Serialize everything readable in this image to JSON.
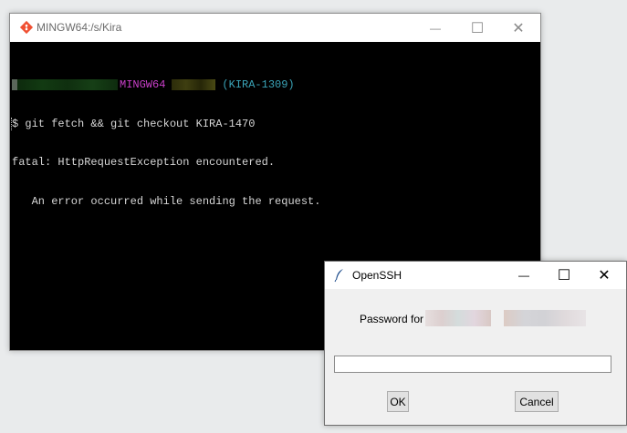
{
  "terminal": {
    "title": "MINGW64:/s/Kira",
    "prompt": {
      "env": "MINGW64",
      "branch": "(KIRA-1309)"
    },
    "lines": [
      "$ git fetch && git checkout KIRA-1470",
      "fatal: HttpRequestException encountered.",
      "   An error occurred while sending the request."
    ],
    "window_controls": {
      "minimize": "—",
      "maximize": "☐",
      "close": "✕"
    }
  },
  "dialog": {
    "title": "OpenSSH",
    "password_label": "Password for",
    "ok_label": "OK",
    "cancel_label": "Cancel",
    "window_controls": {
      "minimize": "—",
      "maximize": "☐",
      "close": "✕"
    }
  },
  "colors": {
    "prompt_env": "#c93fc9",
    "prompt_branch": "#3aa4b8",
    "terminal_text": "#d6d6d6",
    "terminal_bg": "#000000"
  }
}
